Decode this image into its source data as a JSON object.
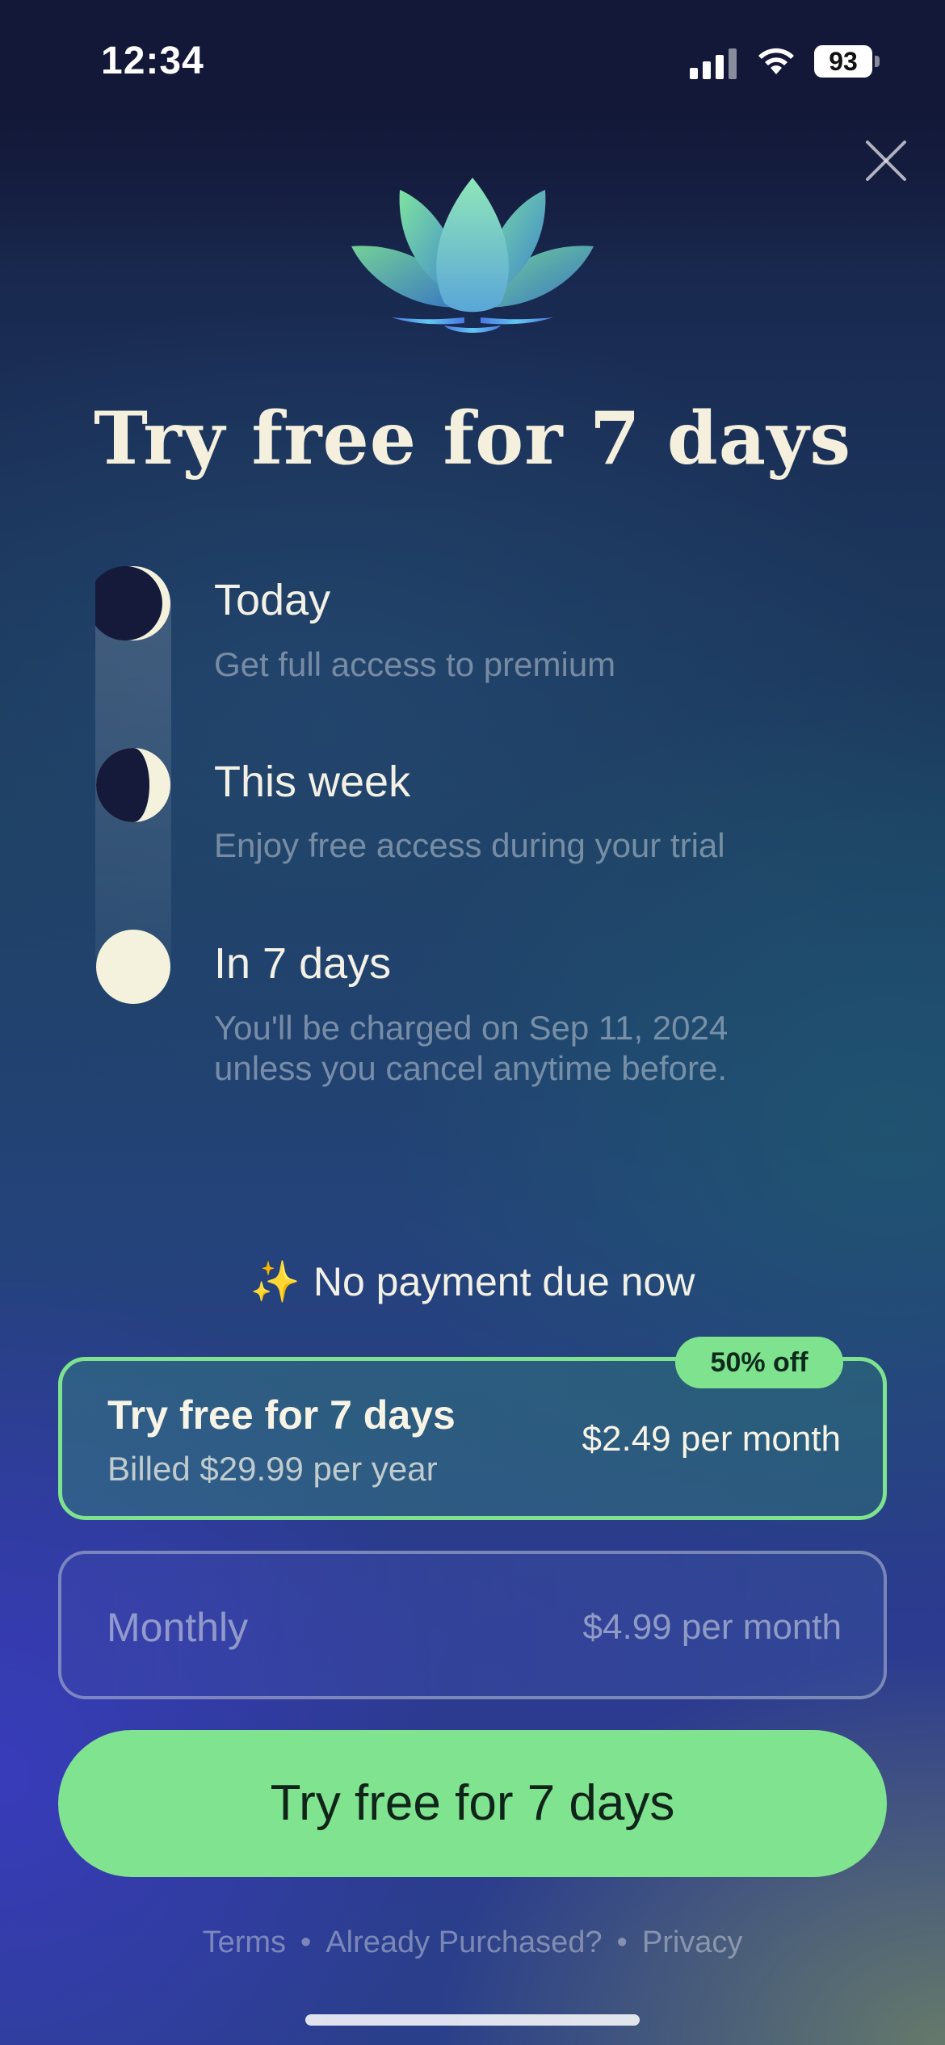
{
  "status_bar": {
    "time": "12:34",
    "battery": "93"
  },
  "headline": "Try free for 7 days",
  "timeline": [
    {
      "title": "Today",
      "description": "Get full access to premium",
      "icon": "crescent-moon-icon"
    },
    {
      "title": "This week",
      "description": "Enjoy free access during your trial",
      "icon": "half-moon-icon"
    },
    {
      "title": "In 7 days",
      "description_lines": [
        "You'll be charged on Sep 11, 2024",
        "unless you cancel anytime before."
      ],
      "icon": "full-moon-icon"
    }
  ],
  "no_payment": {
    "sparkle": "✨",
    "text": "No payment due now"
  },
  "plans": {
    "yearly": {
      "badge": "50% off",
      "title": "Try free for 7 days",
      "billing": "Billed $29.99 per year",
      "price": "$2.49 per month",
      "selected": true
    },
    "monthly": {
      "title": "Monthly",
      "price": "$4.99 per month",
      "selected": false
    }
  },
  "cta_label": "Try free for 7 days",
  "footer": {
    "terms": "Terms",
    "separator": "•",
    "restore": "Already Purchased?",
    "privacy": "Privacy"
  },
  "colors": {
    "accent": "#80e38f",
    "moon": "#f4f2dc",
    "moon_dark": "#151a3a",
    "headline": "#f4f0dd"
  }
}
